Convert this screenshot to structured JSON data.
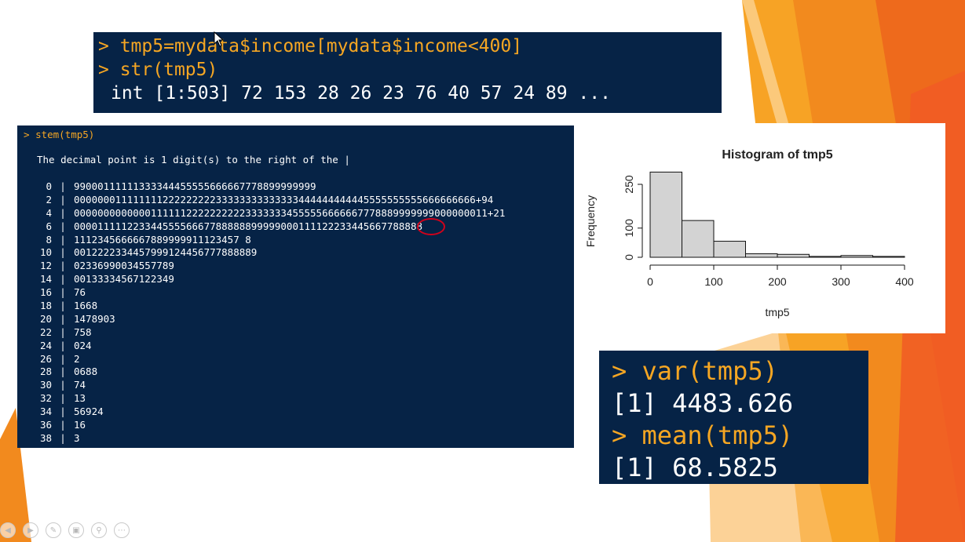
{
  "top_console": {
    "line1_prompt": "> ",
    "line1_cmd": "tmp5=mydata$income[mydata$income<400]",
    "line2_prompt": "> ",
    "line2_cmd": "str(tmp5)",
    "line3_output": "int [1:503] 72 153 28 26 23 76 40 57 24 89 ..."
  },
  "stem_console": {
    "cmd_prompt": "> ",
    "cmd": "stem(tmp5)",
    "note": "The decimal point is 1 digit(s) to the right of the |",
    "rows": [
      {
        "stem": "0",
        "leaves": "99000111111333344455555666667778899999999"
      },
      {
        "stem": "2",
        "leaves": "00000001111111122222222233333333333333444444444445555555555666666666+94"
      },
      {
        "stem": "4",
        "leaves": "0000000000000111111222222222233333334555556666667778889999999000000011+21"
      },
      {
        "stem": "6",
        "leaves": "00001111122334455556667788888899999000111122233445667788888"
      },
      {
        "stem": "8",
        "leaves": "1112345666667889999911123457 8"
      },
      {
        "stem": "10",
        "leaves": "0012222334457999124456777888889"
      },
      {
        "stem": "12",
        "leaves": "02336990034557789"
      },
      {
        "stem": "14",
        "leaves": "00133334567122349"
      },
      {
        "stem": "16",
        "leaves": "76"
      },
      {
        "stem": "18",
        "leaves": "1668"
      },
      {
        "stem": "20",
        "leaves": "1478903"
      },
      {
        "stem": "22",
        "leaves": "758"
      },
      {
        "stem": "24",
        "leaves": "024"
      },
      {
        "stem": "26",
        "leaves": "2"
      },
      {
        "stem": "28",
        "leaves": "0688"
      },
      {
        "stem": "30",
        "leaves": "74"
      },
      {
        "stem": "32",
        "leaves": "13"
      },
      {
        "stem": "34",
        "leaves": "56924"
      },
      {
        "stem": "36",
        "leaves": "16"
      },
      {
        "stem": "38",
        "leaves": "3"
      }
    ]
  },
  "stats_console": {
    "var_prompt": "> ",
    "var_cmd": "var(tmp5)",
    "var_result": "[1] 4483.626",
    "mean_prompt": "> ",
    "mean_cmd": "mean(tmp5)",
    "mean_result": "[1] 68.5825"
  },
  "chart_data": {
    "type": "bar",
    "title": "Histogram of tmp5",
    "xlabel": "tmp5",
    "ylabel": "Frequency",
    "bins": [
      [
        0,
        50
      ],
      [
        50,
        100
      ],
      [
        100,
        150
      ],
      [
        150,
        200
      ],
      [
        200,
        250
      ],
      [
        250,
        300
      ],
      [
        300,
        350
      ],
      [
        350,
        400
      ]
    ],
    "values": [
      292,
      126,
      55,
      12,
      10,
      3,
      6,
      3
    ],
    "xlim": [
      0,
      400
    ],
    "ylim": [
      0,
      250
    ],
    "xticks": [
      0,
      100,
      200,
      300,
      400
    ],
    "yticks": [
      0,
      100,
      250
    ],
    "bar_color": "#d3d3d3"
  },
  "colors": {
    "console_bg": "#062346",
    "prompt": "#f5a623",
    "highlight_circle": "#d0021b"
  },
  "toolbar": {
    "icons": [
      "previous-icon",
      "next-icon",
      "pen-icon",
      "slides-icon",
      "zoom-icon",
      "more-icon"
    ]
  }
}
